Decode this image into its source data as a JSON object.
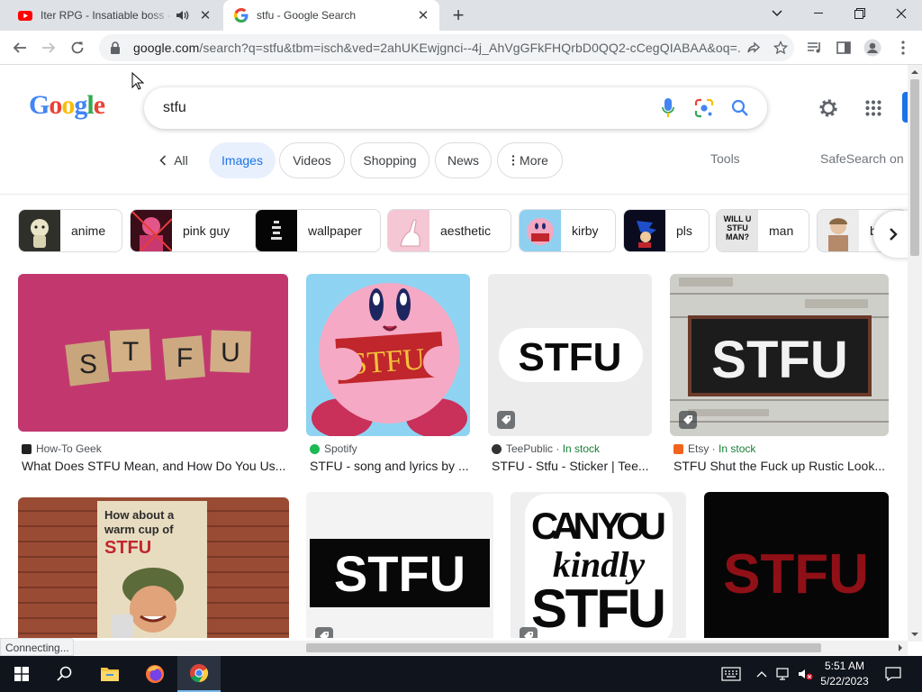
{
  "browser": {
    "tabs": [
      {
        "title": "Iter RPG - Insatiable boss - Y",
        "active": false,
        "favicon": "youtube-icon",
        "audio": true
      },
      {
        "title": "stfu - Google Search",
        "active": true,
        "favicon": "google-g-icon"
      }
    ],
    "url_host": "google.com",
    "url_rest": "/search?q=stfu&tbm=isch&ved=2ahUKEwjgnci--4j_AhVgGFkFHQrbD0QQ2-cCegQIABAA&oq=..."
  },
  "google": {
    "logo": [
      "G",
      "o",
      "o",
      "g",
      "l",
      "e"
    ],
    "query": "stfu",
    "nav": {
      "all": "All",
      "tabs": [
        "Images",
        "Videos",
        "Shopping",
        "News",
        "More"
      ],
      "selected": "Images",
      "tools": "Tools",
      "safesearch": "SafeSearch on"
    },
    "related": [
      "anime",
      "pink guy",
      "wallpaper",
      "aesthetic",
      "kirby",
      "pls",
      "man",
      "b"
    ],
    "results": [
      {
        "source": "How-To Geek",
        "in_stock": "",
        "title": "What Does STFU Mean, and How Do You Us...",
        "image_text": "S T F U"
      },
      {
        "source": "Spotify",
        "in_stock": "",
        "title": "STFU - song and lyrics by ...",
        "image_text": "STFU"
      },
      {
        "source": "TeePublic",
        "in_stock": "In stock",
        "title": "STFU - Stfu - Sticker | Tee...",
        "image_text": "STFU"
      },
      {
        "source": "Etsy",
        "in_stock": "In stock",
        "title": "STFU Shut the Fuck up Rustic Look...",
        "image_text": "STFU"
      }
    ],
    "results_row2": [
      {
        "image_text": [
          "How about a",
          "warm cup of",
          "STFU"
        ]
      },
      {
        "image_text": "STFU"
      },
      {
        "image_text": [
          "CAN YOU",
          "kindly",
          "STFU"
        ]
      },
      {
        "image_text": "STFU"
      }
    ],
    "related_thumb_text": {
      "man": "WILL U STFU MAN?"
    }
  },
  "status": "Connecting...",
  "taskbar": {
    "time": "5:51 AM",
    "date": "5/22/2023"
  },
  "colors": {
    "accent": "#1a73e8",
    "chip_selected_bg": "#e8f0fe",
    "in_stock": "#188038",
    "taskbar": "#10141c"
  }
}
